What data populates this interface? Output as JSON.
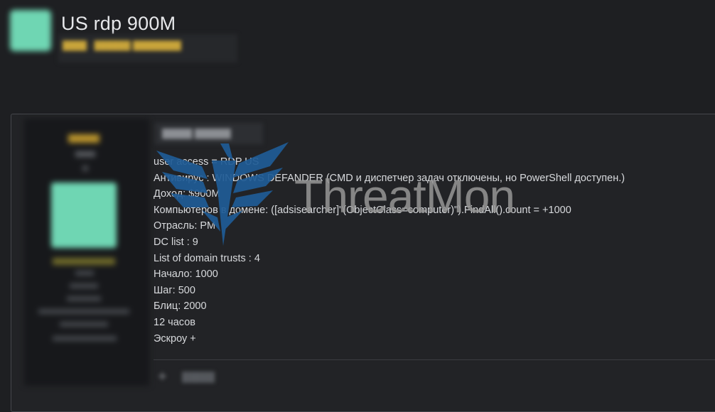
{
  "thread": {
    "title": "US rdp 900M",
    "meta": "████ · ██████ ████████"
  },
  "post": {
    "date": "█████ ██████",
    "lines": [
      "user access  = RDP  US",
      "Антивирус : WINDOWS DEFANDER (CMD и диспетчер задач отключены, но PowerShell доступен.)",
      "Доход: $900M",
      "Компьютеров в домене: ([adsisearcher]\"(ObjectClass=computer)\").FindAll().count    = +1000",
      "Отрасль: PM",
      "DC list : 9",
      "List of domain trusts : 4",
      "Начало: 1000",
      "Шаг: 500",
      "Блиц: 2000",
      "12 часов",
      "Эскроу +"
    ],
    "actions": {
      "plus": "+",
      "like": "█████"
    }
  },
  "watermark": {
    "text": "ThreatMon"
  },
  "colors": {
    "background": "#1e1f22",
    "avatar": "#6fd6b3",
    "username": "#b8932c",
    "watermark_logo": "#1f5c96"
  }
}
